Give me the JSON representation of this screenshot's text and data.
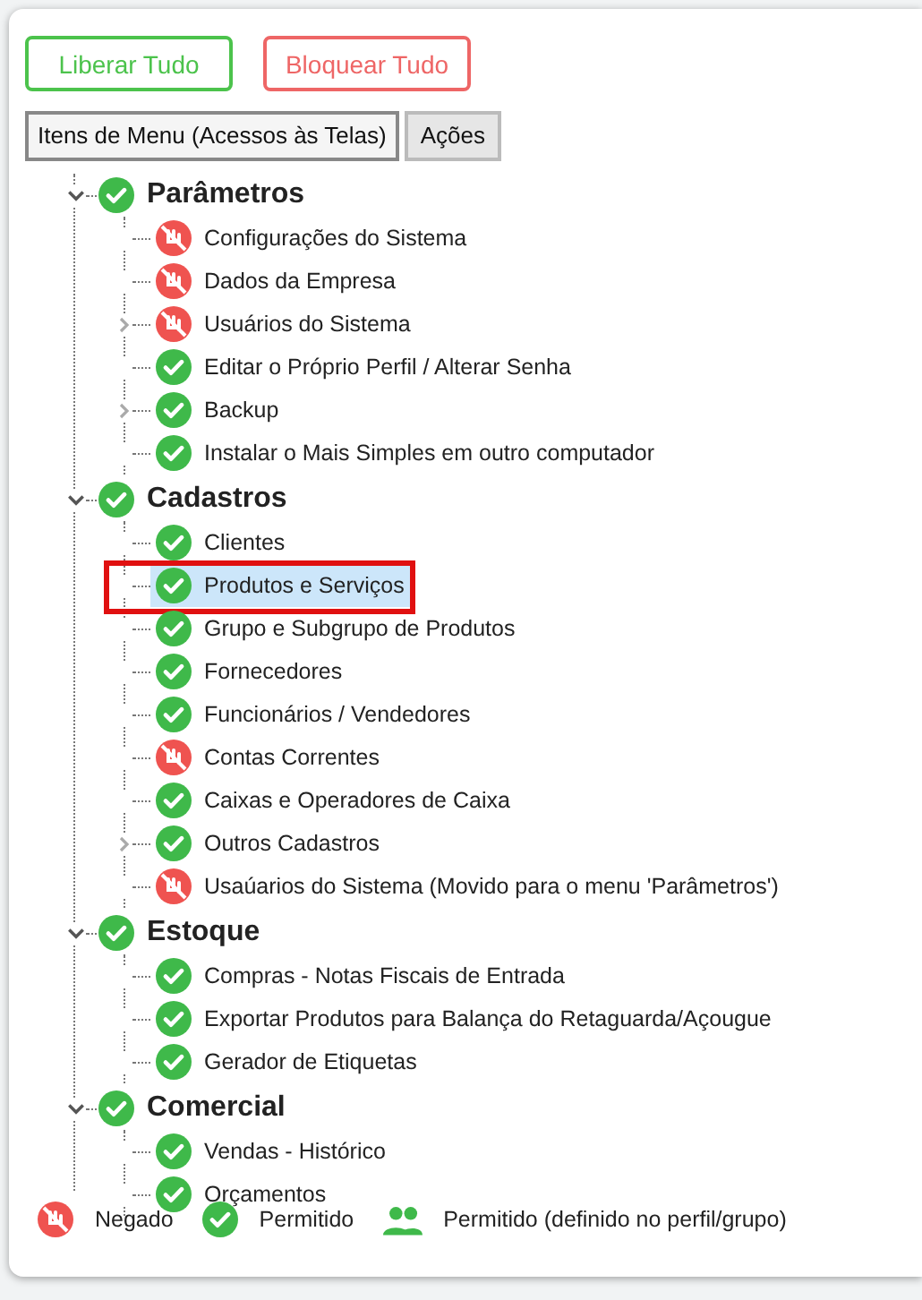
{
  "buttons": [
    {
      "label": "Liberar Tudo",
      "kind": "allow"
    },
    {
      "label": "Bloquear Tudo",
      "kind": "block"
    }
  ],
  "tabs": [
    {
      "label": "Itens de Menu (Acessos às Telas)",
      "selected": true
    },
    {
      "label": "Ações",
      "selected": false
    }
  ],
  "tree": [
    {
      "label": "Parâmetros",
      "kind": "allowed",
      "expanded": true,
      "children": [
        {
          "label": "Configurações do Sistema",
          "kind": "denied",
          "selected": false
        },
        {
          "label": "Dados da Empresa",
          "kind": "denied",
          "selected": false
        },
        {
          "label": "Usuários do Sistema",
          "kind": "denied",
          "expanded": false,
          "selected": false
        },
        {
          "label": "Editar o Próprio Perfil / Alterar Senha",
          "kind": "allowed",
          "selected": false
        },
        {
          "label": "Backup",
          "kind": "allowed",
          "expanded": false,
          "selected": false
        },
        {
          "label": "Instalar o Mais Simples em outro computador",
          "kind": "allowed",
          "selected": false
        }
      ]
    },
    {
      "label": "Cadastros",
      "kind": "allowed",
      "expanded": true,
      "children": [
        {
          "label": "Clientes",
          "kind": "allowed",
          "selected": false
        },
        {
          "label": "Produtos e Serviços",
          "kind": "allowed",
          "selected": true,
          "marked": true
        },
        {
          "label": "Grupo e Subgrupo de Produtos",
          "kind": "allowed",
          "selected": false
        },
        {
          "label": "Fornecedores",
          "kind": "allowed",
          "selected": false
        },
        {
          "label": "Funcionários / Vendedores",
          "kind": "allowed",
          "selected": false
        },
        {
          "label": "Contas Correntes",
          "kind": "denied",
          "selected": false
        },
        {
          "label": "Caixas e Operadores de Caixa",
          "kind": "allowed",
          "selected": false
        },
        {
          "label": "Outros Cadastros",
          "kind": "allowed",
          "expanded": false,
          "selected": false
        },
        {
          "label": "Usaúarios do Sistema (Movido para o menu 'Parâmetros')",
          "kind": "denied",
          "selected": false
        }
      ]
    },
    {
      "label": "Estoque",
      "kind": "allowed",
      "expanded": true,
      "children": [
        {
          "label": "Compras - Notas Fiscais de Entrada",
          "kind": "allowed",
          "selected": false
        },
        {
          "label": "Exportar Produtos para Balança do Retaguarda/Açougue",
          "kind": "allowed",
          "selected": false
        },
        {
          "label": "Gerador de Etiquetas",
          "kind": "allowed",
          "selected": false
        }
      ]
    },
    {
      "label": "Comercial",
      "kind": "allowed",
      "expanded": true,
      "children": [
        {
          "label": "Vendas - Histórico",
          "kind": "allowed",
          "selected": false
        },
        {
          "label": "Orçamentos",
          "kind": "allowed",
          "selected": false
        }
      ]
    }
  ],
  "legend": [
    {
      "label": "Negado",
      "kind": "denied"
    },
    {
      "label": "Permitido",
      "kind": "allowed"
    },
    {
      "label": "Permitido (definido no perfil/grupo)",
      "kind": "group"
    }
  ]
}
